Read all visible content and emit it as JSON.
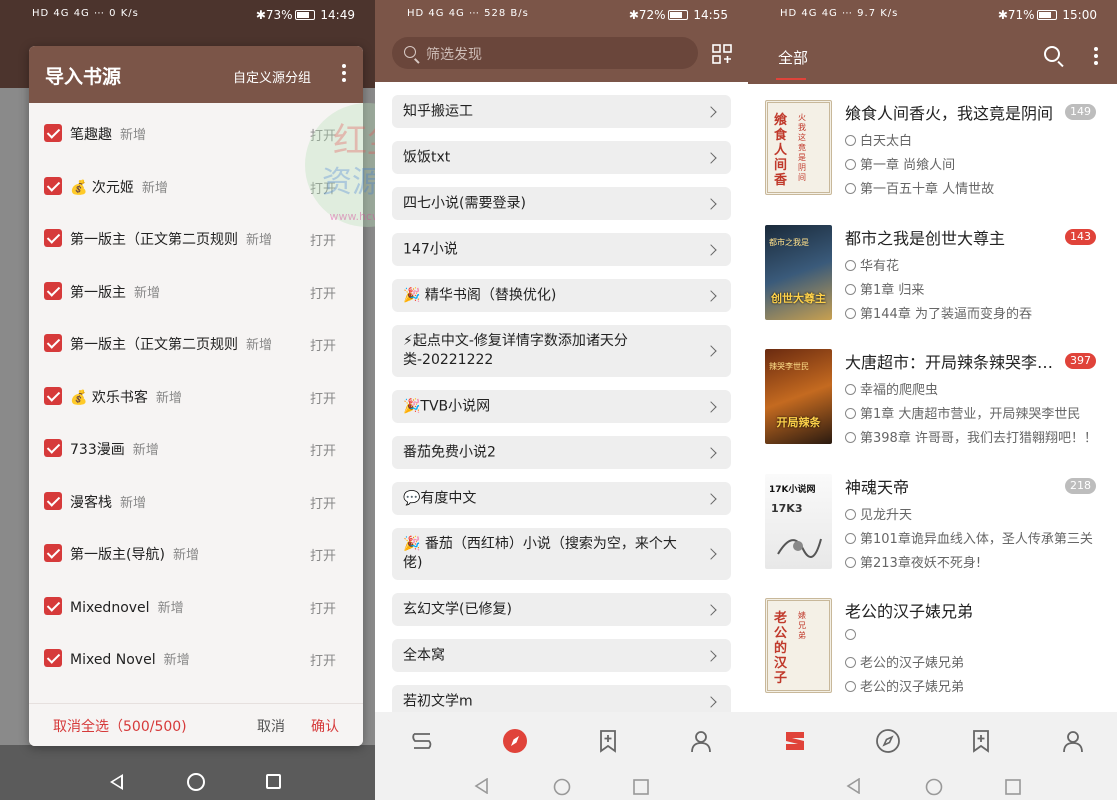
{
  "screen1": {
    "status": {
      "left": "HD 4G 4G ⋯ 0 K/s",
      "right": "✱73%",
      "time": "14:49"
    },
    "dialog": {
      "title": "导入书源",
      "group_label": "自定义源分组",
      "new_label": "新增",
      "open_label": "打开",
      "sources": [
        "笔趣趣",
        "💰 次元姬",
        "第一版主（正文第二页规则",
        "第一版主",
        "第一版主（正文第二页规则",
        "💰 欢乐书客",
        "733漫画",
        "漫客栈",
        "第一版主(导航)",
        "Mixednovel",
        "Mixed Novel"
      ],
      "cancel_all": "取消全选（500/500)",
      "cancel": "取消",
      "confirm": "确认"
    },
    "colors": {
      "header": "#7b5548",
      "accent": "#d63a3a"
    }
  },
  "screen2": {
    "status": {
      "left": "HD 4G 4G ⋯ 528 B/s",
      "right": "✱72%",
      "time": "14:55"
    },
    "search_placeholder": "筛选发现",
    "items": [
      "知乎搬运工",
      "饭饭txt",
      "四七小说(需要登录)",
      "147小说",
      "🎉 精华书阁（替换优化)",
      "⚡起点中文-修复详情字数添加诸天分类-20221222",
      "🎉TVB小说网",
      "番茄免费小说2",
      "💬有度中文",
      "🎉 番茄（西红柿）小说（搜索为空，来个大佬)",
      "玄幻文学(已修复)",
      "全本窝",
      "若初文学m"
    ],
    "tabs": [
      "bookshelf-icon",
      "compass-icon",
      "bookmark-icon",
      "profile-icon"
    ],
    "active_tab": "compass-icon"
  },
  "screen3": {
    "status": {
      "left": "HD 4G 4G ⋯ 9.7 K/s",
      "right": "✱71%",
      "time": "15:00"
    },
    "tab_all": "全部",
    "books": [
      {
        "title": "飨食人间香火，我这竟是阴间",
        "author": "白天太白",
        "last_read": "第一章 尚飨人间",
        "latest": "第一百五十章 人情世故",
        "badge": "149",
        "badge_color": "#bdbdbd",
        "cover_text": "飨食人间香",
        "cover_sub": "火我这竟是阴间",
        "cover_author": "白天太白"
      },
      {
        "title": "都市之我是创世大尊主",
        "author": "华有花",
        "last_read": "第1章 归来",
        "latest": "第144章 为了装逼而变身的吞",
        "badge": "143",
        "badge_color": "#e0433a",
        "cover_text": "创世大尊主",
        "cover_sub": "都市之我是",
        "cover_author": ""
      },
      {
        "title": "大唐超市：开局辣条辣哭李世民",
        "author": "幸福的爬爬虫",
        "last_read": "第1章 大唐超市营业，开局辣哭李世民",
        "latest": "第398章 许哥哥，我们去打猎翱翔吧！！",
        "badge": "397",
        "badge_color": "#e0433a",
        "cover_text": "开局辣条",
        "cover_sub": "辣哭李世民",
        "cover_author": ""
      },
      {
        "title": "神魂天帝",
        "author": "见龙升天",
        "last_read": "第101章诡异血线入体，圣人传承第三关",
        "latest": "第213章夜妖不死身!",
        "badge": "218",
        "badge_color": "#bdbdbd",
        "cover_text": "17K小说网",
        "cover_sub": "17K3",
        "cover_author": ""
      },
      {
        "title": "老公的汉子婊兄弟",
        "author": "",
        "last_read": "老公的汉子婊兄弟",
        "latest": "老公的汉子婊兄弟",
        "badge": "",
        "badge_color": "#bdbdbd",
        "cover_text": "老公的汉子",
        "cover_sub": "婊兄弟",
        "cover_author": ""
      }
    ],
    "tabs": [
      "bookshelf-icon",
      "compass-icon",
      "bookmark-icon",
      "profile-icon"
    ],
    "active_tab": "bookshelf-icon"
  },
  "watermark": {
    "line1": "红尘",
    "line2": "资源网",
    "url": "www.hcw3.cn"
  }
}
